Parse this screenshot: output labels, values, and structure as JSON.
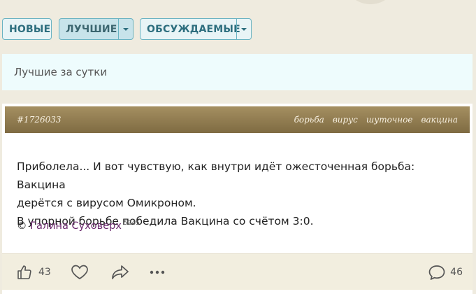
{
  "tabs": {
    "new_label": "НОВЫЕ",
    "best_label": "ЛУЧШИЕ",
    "discussed_label": "ОБСУЖДАЕМЫЕ"
  },
  "period_label": "Лучшие за сутки",
  "post": {
    "id": "#1726033",
    "tags": [
      "борьба",
      "вирус",
      "шуточное",
      "вакцина"
    ],
    "text_lines": [
      "Приболела... И вот чувствую, как внутри идёт ожесточенная борьба: Вакцина",
      "дерётся с вирусом Омикроном.",
      "В упорной борьбе победила Вакцина со счётом 3:0."
    ],
    "copyright": "©",
    "author": "Галина Суховерх",
    "author_rating": "5245",
    "likes": "43",
    "comments": "46"
  },
  "colors": {
    "accent": "#6ab3c2",
    "header_brown": "#8f7a4f",
    "author": "#6b2a6e",
    "background": "#efebdf"
  }
}
